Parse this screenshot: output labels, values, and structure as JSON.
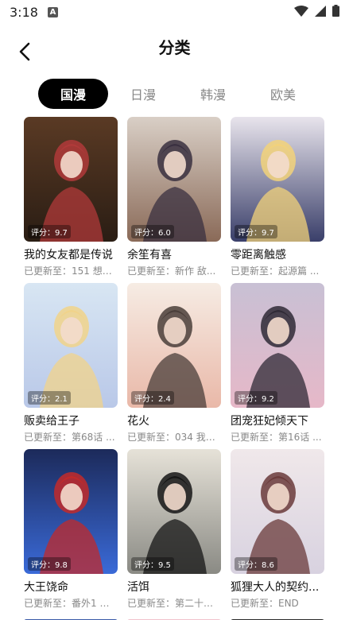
{
  "status": {
    "time": "3:18",
    "notification": "A"
  },
  "header": {
    "title": "分类"
  },
  "tabs": [
    {
      "label": "国漫",
      "active": true
    },
    {
      "label": "日漫",
      "active": false
    },
    {
      "label": "韩漫",
      "active": false
    },
    {
      "label": "欧美",
      "active": false
    }
  ],
  "comics": [
    {
      "title": "我的女友都是传说",
      "score": "评分：9.7",
      "update": "已更新至：151 想通...",
      "colors": [
        "#5a3a24",
        "#b03a3a",
        "#2a1d14"
      ]
    },
    {
      "title": "余笙有喜",
      "score": "评分：6.0",
      "update": "已更新至：新作 敌...",
      "colors": [
        "#d9cfc6",
        "#3a3040",
        "#8a6a58"
      ]
    },
    {
      "title": "零距离触感",
      "score": "评分：9.7",
      "update": "已更新至：起源篇 ...",
      "colors": [
        "#e8e4ec",
        "#f2d27a",
        "#3a3f6a"
      ]
    },
    {
      "title": "贩卖给王子",
      "score": "评分：2.1",
      "update": "已更新至：第68话 ...",
      "colors": [
        "#d8e6f3",
        "#f1d38a",
        "#b9c8e8"
      ]
    },
    {
      "title": "花火",
      "score": "评分：2.4",
      "update": "已更新至：034 我永...",
      "colors": [
        "#f6ece4",
        "#4a3e3a",
        "#e9b8a8"
      ]
    },
    {
      "title": "团宠狂妃倾天下",
      "score": "评分：9.2",
      "update": "已更新至：第16话 ...",
      "colors": [
        "#c8c0d4",
        "#2f2a36",
        "#e6b8c8"
      ]
    },
    {
      "title": "大王饶命",
      "score": "评分：9.8",
      "update": "已更新至：番外1 兜...",
      "colors": [
        "#1c2a5a",
        "#c22a2a",
        "#3a6ad8"
      ]
    },
    {
      "title": "活饵",
      "score": "评分：9.5",
      "update": "已更新至：第二十二...",
      "colors": [
        "#e6e2d8",
        "#161616",
        "#8a8a84"
      ]
    },
    {
      "title": "狐狸大人的契约...",
      "score": "评分：8.6",
      "update": "已更新至：END",
      "colors": [
        "#f0e8ea",
        "#6a3a3a",
        "#d8d2e0"
      ]
    }
  ],
  "icons": {
    "back": "back-arrow-icon",
    "wifi": "wifi-icon",
    "signal": "signal-icon",
    "battery": "battery-icon"
  }
}
